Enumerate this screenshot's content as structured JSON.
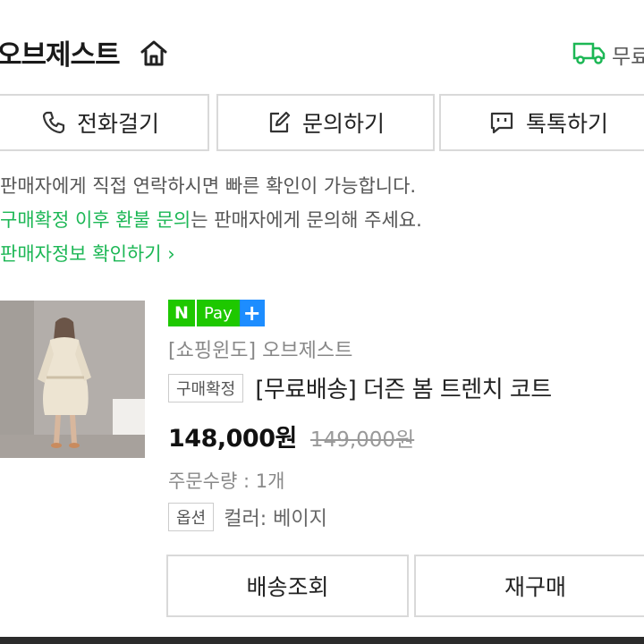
{
  "header": {
    "store_name": "오브제스트",
    "home_icon": "home-icon",
    "delivery_icon": "truck-icon",
    "delivery_text": "무료"
  },
  "contact_buttons": [
    {
      "label": "전화걸기",
      "icon": "phone-icon"
    },
    {
      "label": "문의하기",
      "icon": "edit-icon"
    },
    {
      "label": "톡톡하기",
      "icon": "chat-icon"
    }
  ],
  "notice": {
    "line1": "판매자에게 직접 연락하시면 빠른 확인이 가능합니다.",
    "line2_green": "구매확정 이후 환불 문의",
    "line2_rest": "는 판매자에게 문의해 주세요.",
    "seller_link": "판매자정보 확인하기",
    "seller_link_chevron": "›"
  },
  "order": {
    "npay_n": "N",
    "npay_pay": "Pay",
    "npay_plus": "+",
    "shop": "[쇼핑윈도] 오브제스트",
    "status_tag": "구매확정",
    "title": "[무료배송] 더즌 봄 트렌치 코트",
    "price": "148,000원",
    "original_price": "149,000원",
    "quantity": "주문수량 : 1개",
    "option_tag": "옵션",
    "option_value": "컬러: 베이지"
  },
  "actions": {
    "track": "배송조회",
    "rebuy": "재구매"
  },
  "colors": {
    "accent_green": "#1cb755",
    "npay_green": "#1ec800",
    "npay_blue": "#1d8dff",
    "border": "#d9d9d9"
  }
}
